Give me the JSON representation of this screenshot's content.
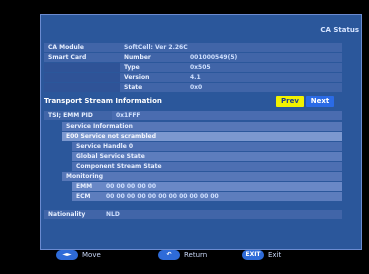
{
  "title": "CA Status",
  "ca": {
    "module_label": "CA Module",
    "module_value": "SoftCell: Ver 2.26C",
    "smartcard_label": "Smart Card",
    "number_label": "Number",
    "number_value": "001000549(5)",
    "type_label": "Type",
    "type_value": "0x505",
    "version_label": "Version",
    "version_value": "4.1",
    "state_label": "State",
    "state_value": "0x0"
  },
  "transport": {
    "heading": "Transport Stream Information",
    "prev": "Prev",
    "next": "Next",
    "ts_label": "TSI; EMM PID",
    "ts_value": "0x1FFF",
    "service_info": "Service Information",
    "e00": "E00 Service not scrambled",
    "service_handle": "Service Handle 0",
    "global_state": "Global Service State",
    "component_state": "Component Stream State",
    "monitoring": "Monitoring",
    "emm_label": "EMM",
    "emm_value": "00 00 00 00 00",
    "ecm_label": "ECM",
    "ecm_value": "00 00 00 00 00 00 00 00 00 00 00"
  },
  "nationality": {
    "label": "Nationality",
    "value": "NLD"
  },
  "footer": {
    "move_key": "◄►",
    "move_label": "Move",
    "return_key": "↶",
    "return_label": "Return",
    "exit_key": "EXIT",
    "exit_label": "Exit"
  }
}
